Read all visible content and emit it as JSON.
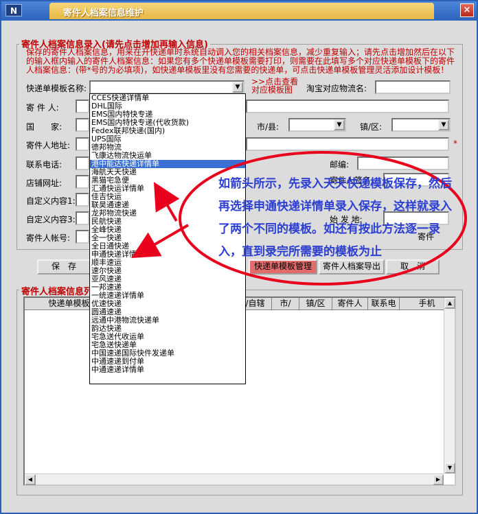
{
  "window": {
    "title": "寄件人档案信息维护",
    "app_icon": "N",
    "close_label": "×"
  },
  "entry_group": {
    "legend": "寄件人档案信息录入(请先点击增加再输入信息)",
    "note_lines": [
      "保存的寄件人档案信息，用来在开快递单时系统自动调入您的相关档案信息，减少重复输入；请先点击增加然后在以下",
      "的输入框内输入的寄件人档案信息：如果您有多个快递单模板需要打印，则需要在此填写多个对应快递单模板下的寄件",
      "人档案信息：(带*号的为必填项)，如快递单模板里没有您需要的快递单，可点击快递单模板管理灵活添加设计模板！"
    ],
    "hint_view_templates": ">>点击查看对应模板图",
    "labels": {
      "template_name": "快递单模板名称:",
      "sender": "寄 件 人:",
      "country": "国　　家:",
      "city": "市/县:",
      "town": "镇/区:",
      "address": "寄件人地址:",
      "phone": "联系电话:",
      "zip": "邮编:",
      "shop_url": "店铺网址:",
      "sign": "寄件人签名:",
      "custom1": "自定义内容1:",
      "custom3": "自定义内容3:",
      "origin": "始 发 地:",
      "account": "寄件人帐号:",
      "taobao": "淘宝对应物流名:",
      "sender_suffix": "寄件"
    },
    "required_mark": "*"
  },
  "buttons": {
    "save": "保　存",
    "template_manage": "快递单模板管理",
    "export": "寄件人档案导出",
    "cancel": "取　消"
  },
  "dropdown": {
    "selected_index": 8,
    "options": [
      "CCES快递详情单",
      "DHL国际",
      "EMS国内特快专递",
      "EMS国内特快专递(代收货款)",
      "Fedex联邦快递(国内)",
      "UPS国际",
      "德邦物流",
      "飞康达物流快运单",
      "港中能达快递详情单",
      "海航天天快递",
      "黑猫宅急便",
      "汇通快运详情单",
      "佳吉快运",
      "联昊通速递",
      "龙邦物流快递",
      "民航快递",
      "全峰快递",
      "全一快递",
      "全日通快递",
      "申通快递详情单",
      "顺丰速运",
      "速尔快递",
      "亚风速递",
      "一邦速递",
      "一统速递详情单",
      "优速快递",
      "圆通速递",
      "远通中港物流快递单",
      "韵达快递",
      "宅急送代收运单",
      "宅急送快递单",
      "中国速递国际快件发递单",
      "中通速递到付单",
      "中通速递详情单"
    ]
  },
  "list_group": {
    "legend": "寄件人档案信息列",
    "columns": [
      "快递单模板",
      "省/自辖",
      "市/",
      "镇/区",
      "寄件人",
      "联系电",
      "手机"
    ]
  },
  "annotation": {
    "text": "如箭头所示，先录入天天快递模板保存，然后再选择申通快递详情单录入保存，这样就录入了两个不同的模板。如还有按此方法逐一录入，直到录完所需要的模板为止",
    "color": "#e8001c"
  },
  "colors": {
    "title_bg": "#2c63bd",
    "legend_red": "#c00000",
    "selection": "#3a6fd4",
    "annotation_text": "#2d3fd0"
  }
}
